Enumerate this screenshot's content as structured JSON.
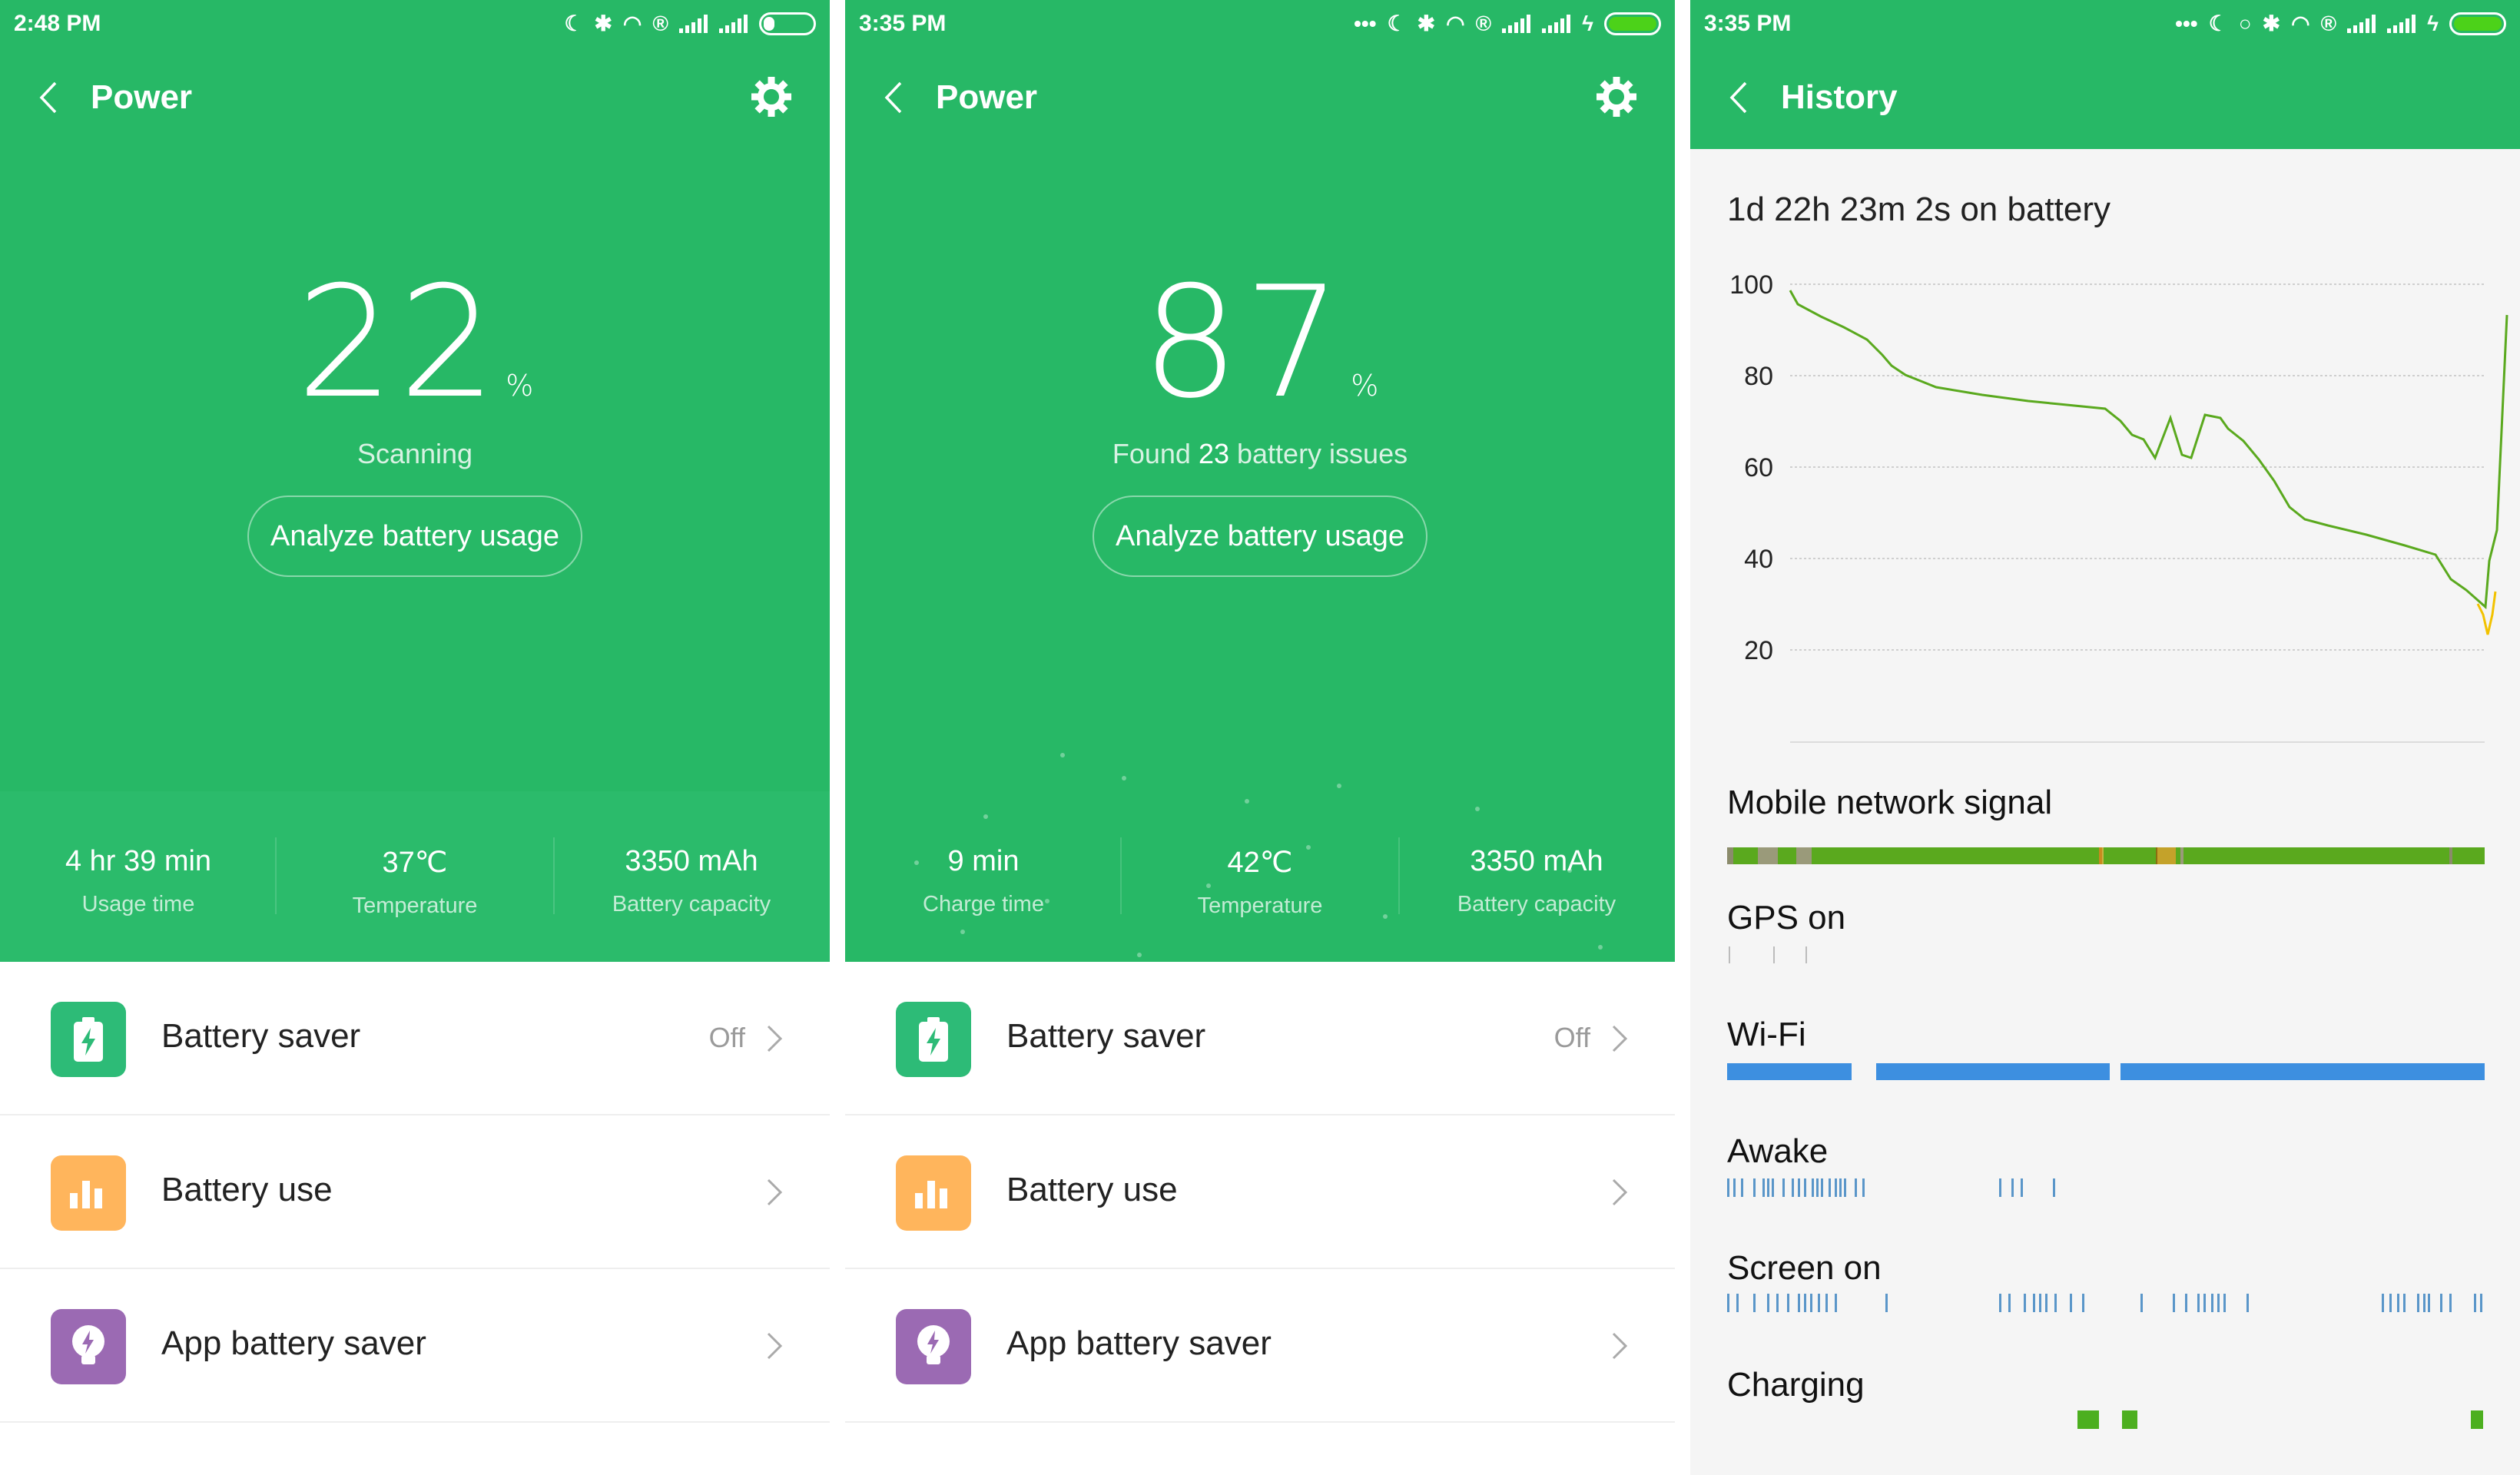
{
  "screens": [
    {
      "time": "2:48 PM",
      "title": "Power",
      "percent": "22",
      "percent_sign": "%",
      "status_text": "Scanning",
      "analyze_button": "Analyze battery usage",
      "stats": [
        {
          "value": "4 hr 39 min",
          "label": "Usage time"
        },
        {
          "value": "37℃",
          "label": "Temperature"
        },
        {
          "value": "3350 mAh",
          "label": "Battery capacity"
        }
      ],
      "list": [
        {
          "label": "Battery saver",
          "value": "Off",
          "icon": "battery-bolt-icon",
          "color": "#2dbb77"
        },
        {
          "label": "Battery use",
          "value": "",
          "icon": "bar-chart-icon",
          "color": "#ffb55c"
        },
        {
          "label": "App battery saver",
          "value": "",
          "icon": "lightbulb-bolt-icon",
          "color": "#9b6ab3"
        }
      ]
    },
    {
      "time": "3:35 PM",
      "title": "Power",
      "percent": "87",
      "percent_sign": "%",
      "status_prefix": "Found ",
      "status_count": "23",
      "status_suffix": " battery issues",
      "analyze_button": "Analyze battery usage",
      "stats": [
        {
          "value": "9 min",
          "label": "Charge time"
        },
        {
          "value": "42℃",
          "label": "Temperature"
        },
        {
          "value": "3350 mAh",
          "label": "Battery capacity"
        }
      ],
      "list": [
        {
          "label": "Battery saver",
          "value": "Off",
          "icon": "battery-bolt-icon",
          "color": "#2dbb77"
        },
        {
          "label": "Battery use",
          "value": "",
          "icon": "bar-chart-icon",
          "color": "#ffb55c"
        },
        {
          "label": "App battery saver",
          "value": "",
          "icon": "lightbulb-bolt-icon",
          "color": "#9b6ab3"
        }
      ]
    },
    {
      "time": "3:35 PM",
      "title": "History",
      "on_battery": "1d 22h 23m 2s on battery",
      "y_ticks": [
        "100",
        "80",
        "60",
        "40",
        "20"
      ],
      "sections": [
        "Mobile network signal",
        "GPS on",
        "Wi-Fi",
        "Awake",
        "Screen on",
        "Charging"
      ]
    }
  ],
  "colors": {
    "accent": "#27b866",
    "line": "#5aa91e",
    "low_line": "#f2c200",
    "wifi": "#3d8fe0",
    "charging": "#4caf1f",
    "tick_blue": "#5a96c9"
  }
}
